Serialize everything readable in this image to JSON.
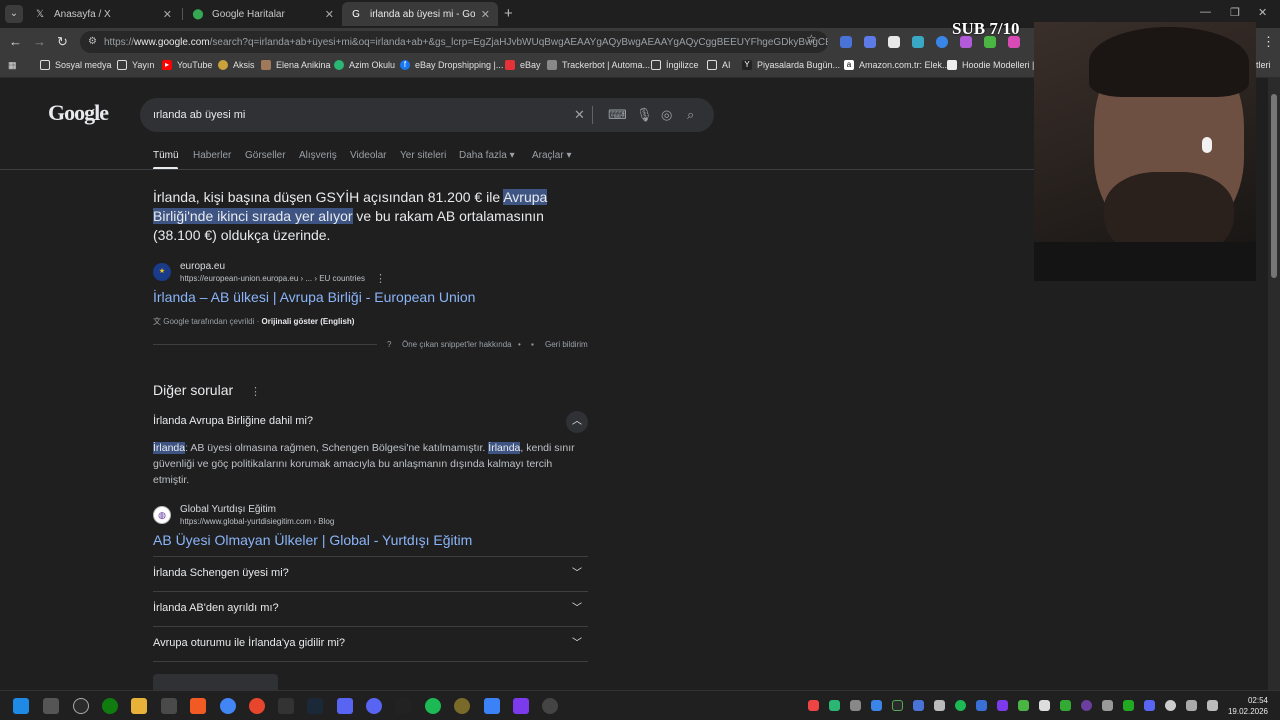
{
  "browser": {
    "tabs": [
      {
        "title": "Anasayfa / X",
        "icon": "x-logo-icon",
        "active": false
      },
      {
        "title": "Google Haritalar",
        "icon": "maps-pin-icon",
        "active": false
      },
      {
        "title": "irlanda ab üyesi mi - Google'da",
        "icon": "google-icon",
        "active": true
      }
    ],
    "url_prefix": "https://",
    "url_host": "www.google.com",
    "url_rest": "/search?q=irlanda+ab+üyesi+mi&oq=irlanda+ab+&gs_lcrp=EgZjaHJvbWUqBwgAEAAYgAQyBwgAEAAYgAQyCggBEEUYFhgeGDkyBwgCEAAY",
    "bookmarks": [
      {
        "label": "Sosyal medya",
        "icon": "folder-icon"
      },
      {
        "label": "Yayın",
        "icon": "folder-icon"
      },
      {
        "label": "YouTube",
        "icon": "youtube-icon"
      },
      {
        "label": "Aksis",
        "icon": "aksis-icon"
      },
      {
        "label": "Elena Anikina",
        "icon": "bookmark-icon"
      },
      {
        "label": "Azim Okulu",
        "icon": "bookmark-icon"
      },
      {
        "label": "eBay Dropshipping |...",
        "icon": "facebook-icon"
      },
      {
        "label": "eBay",
        "icon": "ebay-icon"
      },
      {
        "label": "Trackerbot | Automa...",
        "icon": "bookmark-icon"
      },
      {
        "label": "İngilizce",
        "icon": "folder-icon"
      },
      {
        "label": "AI",
        "icon": "folder-icon"
      },
      {
        "label": "Piyasalarda Bugün...",
        "icon": "bookmark-icon"
      },
      {
        "label": "Amazon.com.tr: Elek...",
        "icon": "amazon-icon"
      },
      {
        "label": "Hoodie Modelleri | L...",
        "icon": "bookmark-icon"
      },
      {
        "label": "tleri",
        "icon": "folder-icon"
      }
    ]
  },
  "google": {
    "logo": "Google",
    "query": "ırlanda ab üyesi mi",
    "search_tabs": [
      "Tümü",
      "Haberler",
      "Görseller",
      "Alışveriş",
      "Videolar",
      "Yer siteleri",
      "Daha fazla ▾",
      "Araçlar ▾"
    ],
    "snippet": {
      "pre": "İrlanda, kişi başına düşen GSYİH açısından 81.200 € ile ",
      "highlight": "Avrupa Birliği'nde ikinci sırada yer alıyor",
      "post": " ve bu rakam AB ortalamasının (38.100 €) oldukça üzerinde."
    },
    "source1": {
      "name": "europa.eu",
      "url": "https://european-union.europa.eu › ... › EU countries",
      "title": "İrlanda – AB ülkesi | Avrupa Birliği - European Union"
    },
    "translated": {
      "label": "Google tarafından çevrildi",
      "sep": "·",
      "original": "Orijinali göster (English)"
    },
    "feedback": {
      "about": "Öne çıkan snippet'ler hakkında",
      "dot": "•",
      "report": "Geri bildirim"
    },
    "paa": {
      "title": "Diğer sorular",
      "questions": [
        "İrlanda Avrupa Birliğine dahil mi?",
        "İrlanda Schengen üyesi mi?",
        "İrlanda AB'den ayrıldı mı?",
        "Avrupa oturumu ile İrlanda'ya gidilir mi?"
      ],
      "answer": {
        "hl1": "İrlanda",
        "part1": ": AB üyesi olmasına rağmen, Schengen Bölgesi'ne katılmamıştır. ",
        "hl2": "İrlanda",
        "part2": ", kendi sınır güvenliği ve göç politikalarını korumak amacıyla bu anlaşmanın dışında kalmayı tercih etmiştir."
      },
      "source2": {
        "name": "Global Yurtdışı Eğitim",
        "url": "https://www.global-yurtdisiegitim.com › Blog",
        "title": "AB Üyesi Olmayan Ülkeler | Global - Yurtdışı Eğitim"
      }
    }
  },
  "overlay": {
    "sub_counter": "SUB 7/10"
  },
  "taskbar": {
    "time": "02:54",
    "date": "19.02.2026"
  },
  "colors": {
    "link": "#8ab4f8",
    "highlight": "#3e5482",
    "background": "#1f1f1f"
  }
}
